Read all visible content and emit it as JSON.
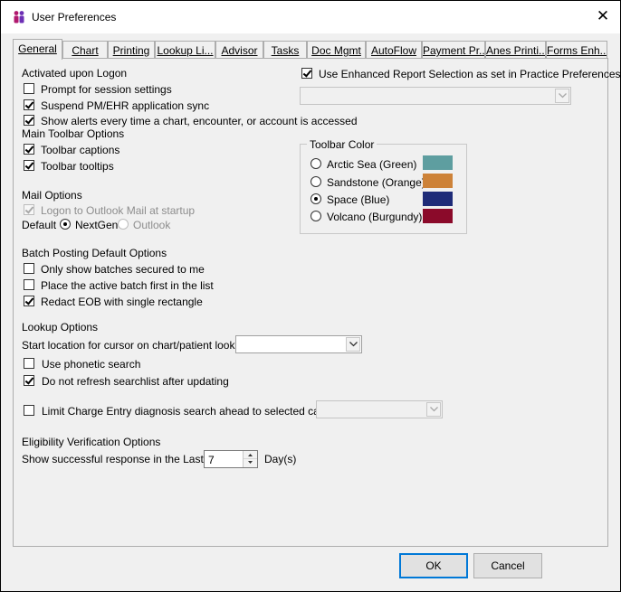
{
  "window": {
    "title": "User Preferences",
    "close_glyph": "✕"
  },
  "tabs": [
    "General",
    "Chart",
    "Printing",
    "Lookup Li...",
    "Advisor",
    "Tasks",
    "Doc Mgmt",
    "AutoFlow",
    "Payment Pr...",
    "Anes Printi...",
    "Forms Enh..."
  ],
  "activated": {
    "heading": "Activated upon Logon",
    "prompt_session": {
      "label": "Prompt for session settings",
      "checked": false
    },
    "suspend_sync": {
      "label": "Suspend PM/EHR application sync",
      "checked": true
    },
    "show_alerts": {
      "label": "Show alerts every time a chart, encounter, or account is accessed",
      "checked": true
    }
  },
  "enhanced_report": {
    "label": "Use Enhanced Report Selection as set in Practice Preferences",
    "checked": true,
    "value": ""
  },
  "main_toolbar": {
    "heading": "Main Toolbar Options",
    "captions": {
      "label": "Toolbar captions",
      "checked": true
    },
    "tooltips": {
      "label": "Toolbar tooltips",
      "checked": true
    }
  },
  "toolbar_color": {
    "heading": "Toolbar Color",
    "options": [
      {
        "label": "Arctic Sea (Green)",
        "color": "#5e9ea0",
        "selected": false
      },
      {
        "label": "Sandstone (Orange)",
        "color": "#cd8238",
        "selected": false
      },
      {
        "label": "Space (Blue)",
        "color": "#1e2b78",
        "selected": true
      },
      {
        "label": "Volcano (Burgundy)",
        "color": "#8b0a2a",
        "selected": false
      }
    ]
  },
  "mail": {
    "heading": "Mail Options",
    "logon_outlook": {
      "label": "Logon to Outlook Mail at startup",
      "checked": true,
      "disabled": true
    },
    "default_label": "Default",
    "nextgen_label": "NextGen",
    "outlook_label": "Outlook"
  },
  "batch": {
    "heading": "Batch Posting Default Options",
    "only_secured": {
      "label": "Only show batches secured to me",
      "checked": false
    },
    "active_first": {
      "label": "Place the active batch first in the list",
      "checked": false
    },
    "redact_eob": {
      "label": "Redact EOB with single rectangle",
      "checked": true
    }
  },
  "lookup": {
    "heading": "Lookup Options",
    "start_location_label": "Start location for cursor on chart/patient lookup",
    "start_location_value": "",
    "phonetic": {
      "label": "Use phonetic search",
      "checked": false
    },
    "no_refresh": {
      "label": "Do not refresh searchlist after updating",
      "checked": true
    }
  },
  "limit_charge": {
    "label": "Limit Charge Entry diagnosis search ahead to selected category",
    "checked": false,
    "value": ""
  },
  "eligibility": {
    "heading": "Eligibility Verification Options",
    "response_label": "Show successful response in the Last",
    "days_value": "7",
    "days_unit": "Day(s)"
  },
  "buttons": {
    "ok": "OK",
    "cancel": "Cancel"
  }
}
